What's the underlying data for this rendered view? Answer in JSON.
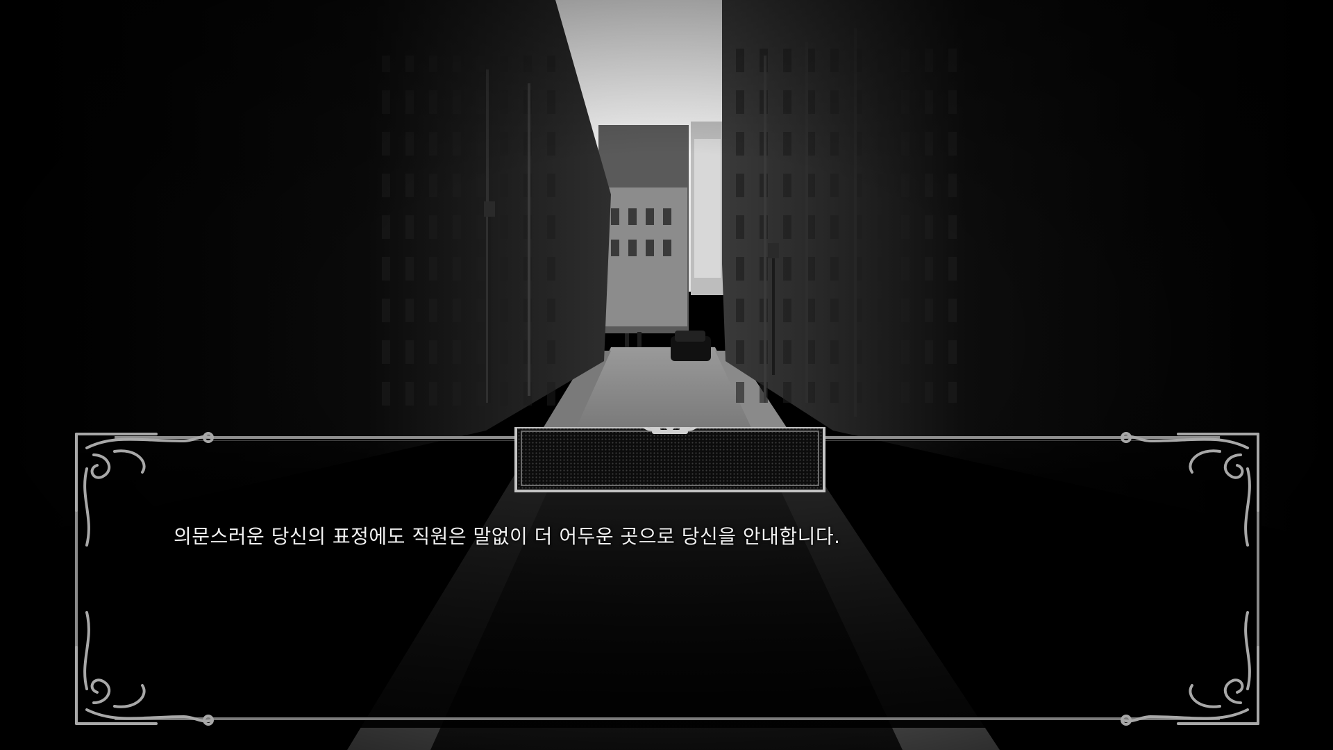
{
  "dialogue": {
    "speaker": "",
    "text": "의문스러운 당신의 표정에도 직원은 말없이 더 어두운 곳으로 당신을 안내합니다."
  },
  "scene": {
    "description_icon": "city-street-background",
    "palette": {
      "sky": "#f4f4f4",
      "building_dark": "#0b0b0b",
      "building_mid": "#2b2b2b",
      "street": "#6e6e6e",
      "frame": "#9a9a9a",
      "text": "#f2f2f2"
    }
  }
}
